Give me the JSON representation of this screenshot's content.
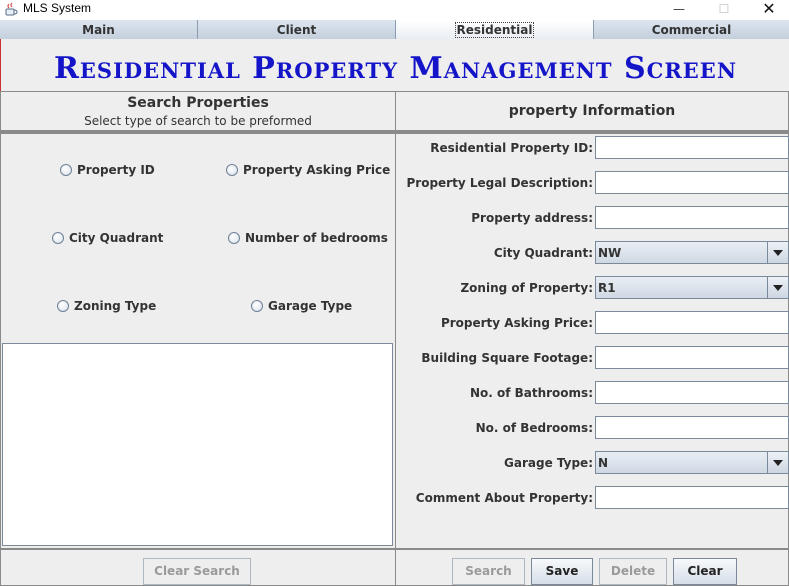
{
  "window": {
    "title": "MLS System",
    "icon": "java-cup-icon"
  },
  "tabs": [
    {
      "label": "Main"
    },
    {
      "label": "Client"
    },
    {
      "label": "Residential",
      "active": true
    },
    {
      "label": "Commercial"
    }
  ],
  "header": {
    "title": "Residential Property Management Screen"
  },
  "search": {
    "title": "Search Properties",
    "subtitle": "Select type of search to be preformed",
    "options": [
      {
        "label": "Property ID"
      },
      {
        "label": "Property Asking Price"
      },
      {
        "label": "City Quadrant"
      },
      {
        "label": "Number of bedrooms"
      },
      {
        "label": "Zoning Type"
      },
      {
        "label": "Garage Type"
      }
    ],
    "clear_label": "Clear Search"
  },
  "info": {
    "title": "property Information",
    "fields": [
      {
        "label": "Residential Property ID:",
        "value": ""
      },
      {
        "label": "Property Legal Description:",
        "value": ""
      },
      {
        "label": "Property address:",
        "value": ""
      },
      {
        "label": "City Quadrant:",
        "value": "NW"
      },
      {
        "label": "Zoning of Property:",
        "value": "R1"
      },
      {
        "label": "Property Asking Price:",
        "value": ""
      },
      {
        "label": "Building Square Footage:",
        "value": ""
      },
      {
        "label": "No. of Bathrooms:",
        "value": ""
      },
      {
        "label": "No. of Bedrooms:",
        "value": ""
      },
      {
        "label": "Garage Type:",
        "value": "N"
      },
      {
        "label": "Comment About Property:",
        "value": ""
      }
    ]
  },
  "buttons": {
    "search": "Search",
    "save": "Save",
    "delete": "Delete",
    "clear": "Clear"
  },
  "colors": {
    "title_blue": "#1414c8",
    "tab_bg": "#c6d1df",
    "window_bg": "#eeeeee"
  }
}
